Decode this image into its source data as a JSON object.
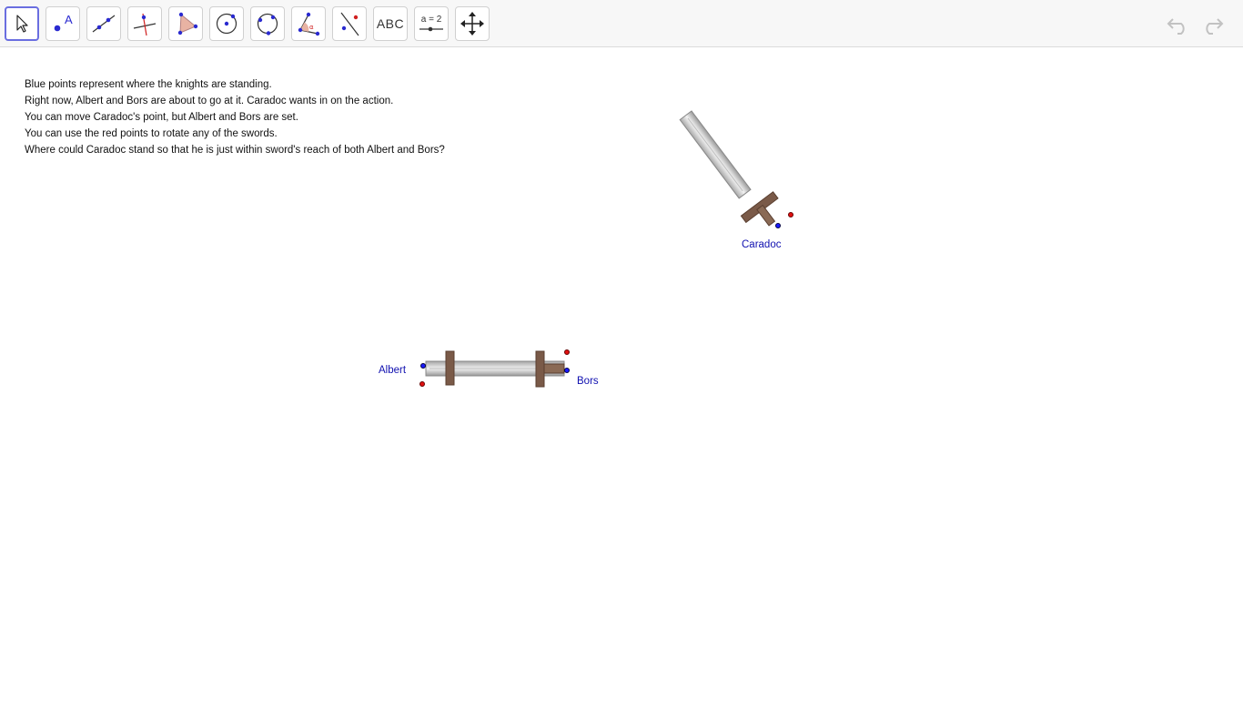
{
  "toolbar": {
    "tools": [
      {
        "name": "move-tool",
        "icon": "cursor-arrow-icon"
      },
      {
        "name": "point-tool",
        "icon": "point-icon",
        "label": "A"
      },
      {
        "name": "line-tool",
        "icon": "line-icon"
      },
      {
        "name": "perpendicular-line-tool",
        "icon": "perpendicular-icon"
      },
      {
        "name": "polygon-tool",
        "icon": "triangle-icon"
      },
      {
        "name": "circle-center-point-tool",
        "icon": "circle-center-icon"
      },
      {
        "name": "circle-three-points-tool",
        "icon": "circle-points-icon"
      },
      {
        "name": "angle-tool",
        "icon": "angle-icon"
      },
      {
        "name": "reflect-tool",
        "icon": "reflect-icon"
      },
      {
        "name": "text-tool",
        "icon": "text-icon",
        "label": "ABC"
      },
      {
        "name": "slider-tool",
        "icon": "slider-icon",
        "label": "a = 2"
      },
      {
        "name": "move-graphics-view-tool",
        "icon": "move-arrows-icon"
      }
    ],
    "undo_icon": "undo-icon",
    "redo_icon": "redo-icon"
  },
  "instructions": [
    "Blue points represent where the knights are standing.",
    "Right now, Albert and Bors are about to go at it. Caradoc wants in on the action.",
    "You can move Caradoc's point, but Albert and Bors are set.",
    "You can use the red points to rotate any of the swords.",
    "Where could Caradoc stand so that he is just within sword's reach of both Albert and Bors?"
  ],
  "knights": {
    "caradoc": "Caradoc",
    "albert": "Albert",
    "bors": "Bors"
  },
  "colors": {
    "knight_point": "#1a1aff",
    "rotate_point": "#e01010",
    "label": "#1010b0",
    "active_tool_border": "#6a6ee0"
  }
}
